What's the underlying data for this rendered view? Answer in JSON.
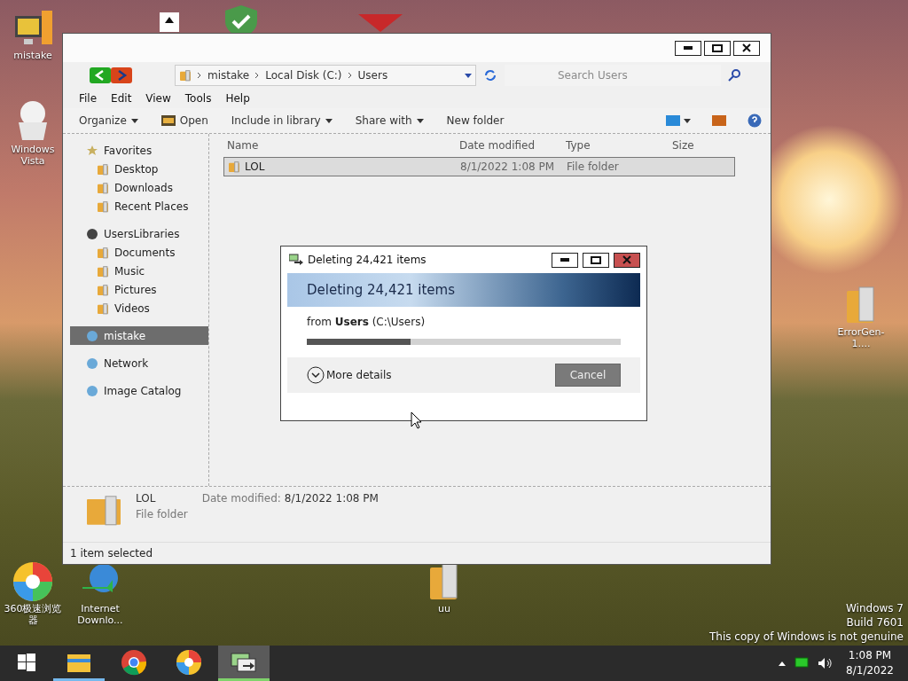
{
  "desktop_icons": [
    {
      "label": "mistake",
      "kind": "computer"
    },
    {
      "label": "Windows Vista",
      "kind": "mascot"
    },
    {
      "label": "ErrorGen-1....",
      "kind": "folder"
    },
    {
      "label": "360极速浏览器",
      "kind": "browser"
    },
    {
      "label": "Internet Downlo...",
      "kind": "downloader"
    },
    {
      "label": "uu",
      "kind": "folder"
    }
  ],
  "explorer": {
    "breadcrumb": [
      "mistake",
      "Local Disk (C:)",
      "Users"
    ],
    "search": {
      "placeholder": "Search Users"
    },
    "menu": [
      "File",
      "Edit",
      "View",
      "Tools",
      "Help"
    ],
    "toolbar": [
      {
        "label": "Organize",
        "has_menu": true
      },
      {
        "label": "Open",
        "has_menu": false
      },
      {
        "label": "Include in library",
        "has_menu": true
      },
      {
        "label": "Share with",
        "has_menu": true
      },
      {
        "label": "New folder",
        "has_menu": false
      }
    ],
    "sidebar": [
      {
        "label": "Favorites",
        "selected": false,
        "children": [
          {
            "label": "Desktop",
            "selected": false
          },
          {
            "label": "Downloads",
            "selected": false
          },
          {
            "label": "Recent Places",
            "selected": false
          }
        ]
      },
      {
        "label": "UsersLibraries",
        "selected": false,
        "children": [
          {
            "label": "Documents",
            "selected": false
          },
          {
            "label": "Music",
            "selected": false
          },
          {
            "label": "Pictures",
            "selected": false
          },
          {
            "label": "Videos",
            "selected": false
          }
        ]
      },
      {
        "label": "mistake",
        "selected": true
      },
      {
        "label": "Network",
        "selected": false
      },
      {
        "label": "Image Catalog",
        "selected": false
      }
    ],
    "columns": [
      "Name",
      "Date modified",
      "Type",
      "Size"
    ],
    "rows": [
      {
        "name": "LOL",
        "date": "8/1/2022 1:08 PM",
        "type": "File folder",
        "selected": true
      }
    ],
    "details": {
      "name": "LOL",
      "type": "File folder",
      "date_label": "Date modified:",
      "date": "8/1/2022 1:08 PM"
    },
    "status_bar": "1 item selected"
  },
  "dialog": {
    "title": "Deleting 24,421 items",
    "heading": "Deleting 24,421 items",
    "source": "from **Users** (C:\\Users)",
    "level": 0.33,
    "details_button": "More details",
    "cancel": "Cancel"
  },
  "genuine_notice": [
    "Windows 7",
    "Build 7601",
    "This copy of Windows is not genuine"
  ],
  "taskbar": {
    "apps": [
      {
        "kind": "explorer",
        "running": true,
        "selected": false
      },
      {
        "kind": "chrome",
        "running": false,
        "selected": false
      },
      {
        "kind": "browser",
        "running": false,
        "selected": false
      },
      {
        "kind": "copy",
        "running": true,
        "selected": true
      }
    ],
    "time": "1:08 PM",
    "date": "8/1/2022"
  }
}
